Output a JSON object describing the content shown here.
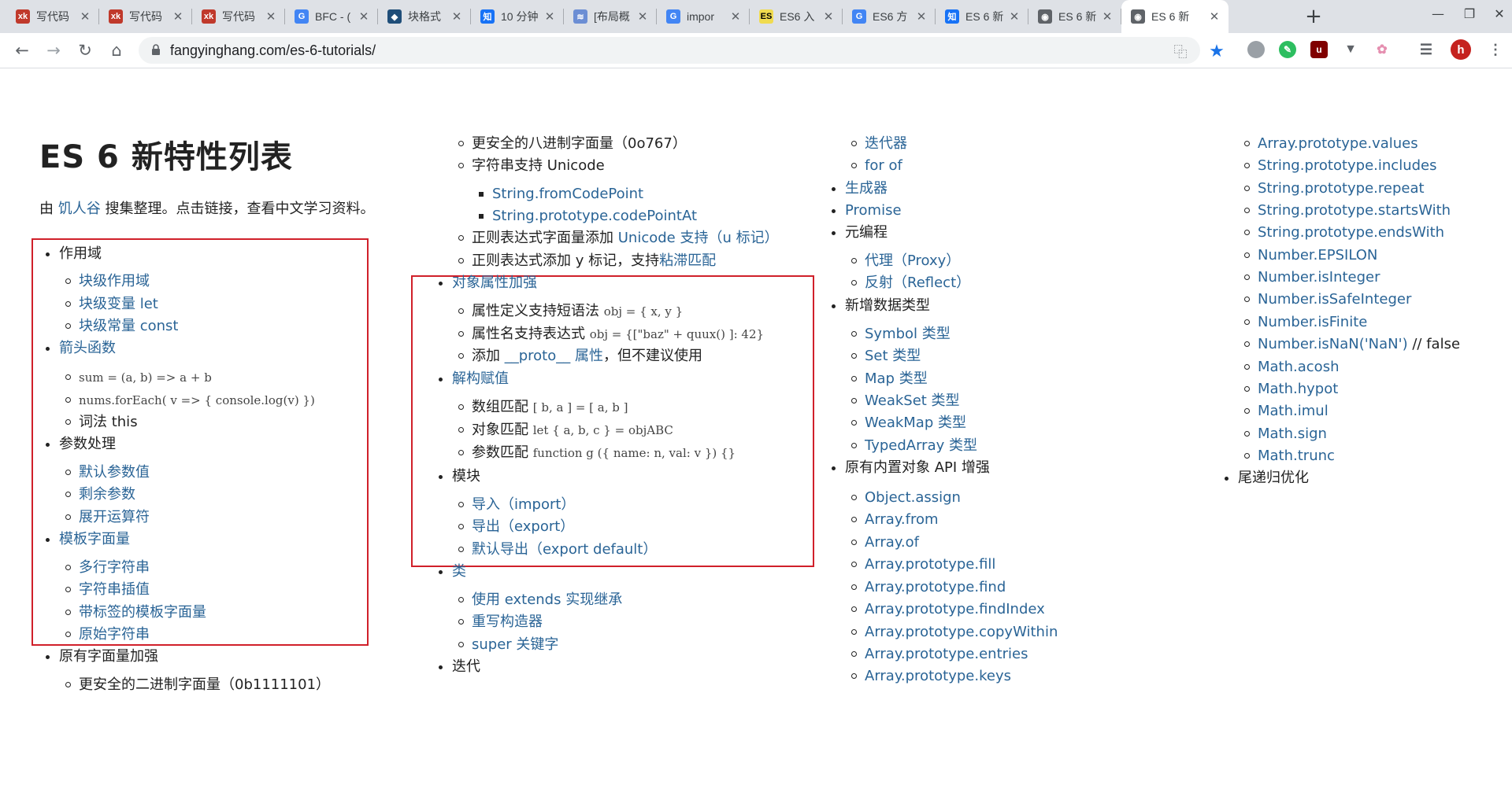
{
  "tabs": [
    {
      "title": "写代码",
      "fav": "xk",
      "color": "#c0392b"
    },
    {
      "title": "写代码",
      "fav": "xk",
      "color": "#c0392b"
    },
    {
      "title": "写代码",
      "fav": "xk",
      "color": "#c0392b"
    },
    {
      "title": "BFC - (",
      "fav": "G",
      "color": "#4285f4"
    },
    {
      "title": "块格式",
      "fav": "◆",
      "color": "#1f4e79"
    },
    {
      "title": "10 分钟",
      "fav": "知",
      "color": "#1772f6"
    },
    {
      "title": "[布局概",
      "fav": "≋",
      "color": "#6c8ed4"
    },
    {
      "title": "impor",
      "fav": "G",
      "color": "#4285f4"
    },
    {
      "title": "ES6 入",
      "fav": "ES",
      "color": "#f0db4f"
    },
    {
      "title": "ES6 方",
      "fav": "G",
      "color": "#4285f4"
    },
    {
      "title": "ES 6 新",
      "fav": "知",
      "color": "#1772f6"
    },
    {
      "title": "ES 6 新",
      "fav": "◉",
      "color": "#5f6368"
    },
    {
      "title": "ES 6 新",
      "fav": "◉",
      "color": "#5f6368",
      "active": true
    }
  ],
  "toolbar": {
    "url": "fangyinghang.com/es-6-tutorials/",
    "avatar_letter": "h"
  },
  "page": {
    "title": "ES 6 新特性列表",
    "intro_prefix": "由 ",
    "intro_author": "饥人谷",
    "intro_suffix": " 搜集整理。点击链接，查看中文学习资料。",
    "col1": {
      "scope": "作用域",
      "block_scope": "块级作用域",
      "let": "块级变量 let",
      "const": "块级常量 const",
      "arrow": "箭头函数",
      "arrow_ex1": "sum = (a, b) => a + b",
      "arrow_ex2": "nums.forEach( v => { console.log(v) })",
      "lexical_this": "词法 this",
      "params": "参数处理",
      "default_params": "默认参数值",
      "rest_params": "剩余参数",
      "spread": "展开运算符",
      "template": "模板字面量",
      "multiline": "多行字符串",
      "interpolation": "字符串插值",
      "tagged": "带标签的模板字面量",
      "raw": "原始字符串",
      "literals": "原有字面量加强",
      "binary": "更安全的二进制字面量（0b1111101）"
    },
    "col2": {
      "octal": "更安全的八进制字面量（0o767）",
      "unicode_prefix": "字符串支持 Unicode",
      "fromcodepoint": "String.fromCodePoint",
      "codepointat": "String.prototype.codePointAt",
      "regex_u_prefix": "正则表达式字面量添加 ",
      "regex_u_link": "Unicode 支持（u 标记）",
      "regex_y_prefix": "正则表达式添加 y 标记，支持",
      "regex_y_link": "粘滞匹配",
      "obj_enhance": "对象属性加强",
      "shorthand_label": "属性定义支持短语法 ",
      "shorthand_code": "obj = { x, y }",
      "computed_label": "属性名支持表达式 ",
      "computed_code": "obj = {[\"baz\" + quux() ]: 42}",
      "proto_prefix": "添加 ",
      "proto_link": "__proto__ 属性",
      "proto_suffix": "，但不建议使用",
      "destructuring": "解构赋值",
      "array_match_label": "数组匹配 ",
      "array_match_code": "[ b, a ] = [ a, b ]",
      "object_match_label": "对象匹配 ",
      "object_match_code": "let { a, b, c } = objABC",
      "param_match_label": "参数匹配 ",
      "param_match_code": "function g ({ name: n, val: v }) {}",
      "modules": "模块",
      "import": "导入（import）",
      "export": "导出（export）",
      "export_default": "默认导出（export default）",
      "class": "类",
      "extends": "使用 extends 实现继承",
      "constructor": "重写构造器",
      "super": "super 关键字",
      "iteration": "迭代"
    },
    "col3": {
      "iterator": "迭代器",
      "for_of": "for of",
      "generator": "生成器",
      "promise": "Promise",
      "meta": "元编程",
      "proxy": "代理（Proxy）",
      "reflect": "反射（Reflect）",
      "new_types": "新增数据类型",
      "types": [
        "Symbol 类型",
        "Set 类型",
        "Map 类型",
        "WeakSet 类型",
        "WeakMap 类型",
        "TypedArray 类型"
      ],
      "builtins": "原有内置对象 API 增强",
      "apis": [
        "Object.assign",
        "Array.from",
        "Array.of",
        "Array.prototype.fill",
        "Array.prototype.find",
        "Array.prototype.findIndex",
        "Array.prototype.copyWithin",
        "Array.prototype.entries",
        "Array.prototype.keys"
      ]
    },
    "col4": {
      "apis": [
        "Array.prototype.values",
        "String.prototype.includes",
        "String.prototype.repeat",
        "String.prototype.startsWith",
        "String.prototype.endsWith",
        "Number.EPSILON",
        "Number.isInteger",
        "Number.isSafeInteger",
        "Number.isFinite"
      ],
      "isnan_link": "Number.isNaN('NaN')",
      "isnan_suffix": " // false",
      "math": [
        "Math.acosh",
        "Math.hypot",
        "Math.imul",
        "Math.sign",
        "Math.trunc"
      ],
      "tail_call": "尾递归优化"
    }
  },
  "colors": {
    "link": "#2a6496",
    "highlight_box": "#d0202a"
  }
}
